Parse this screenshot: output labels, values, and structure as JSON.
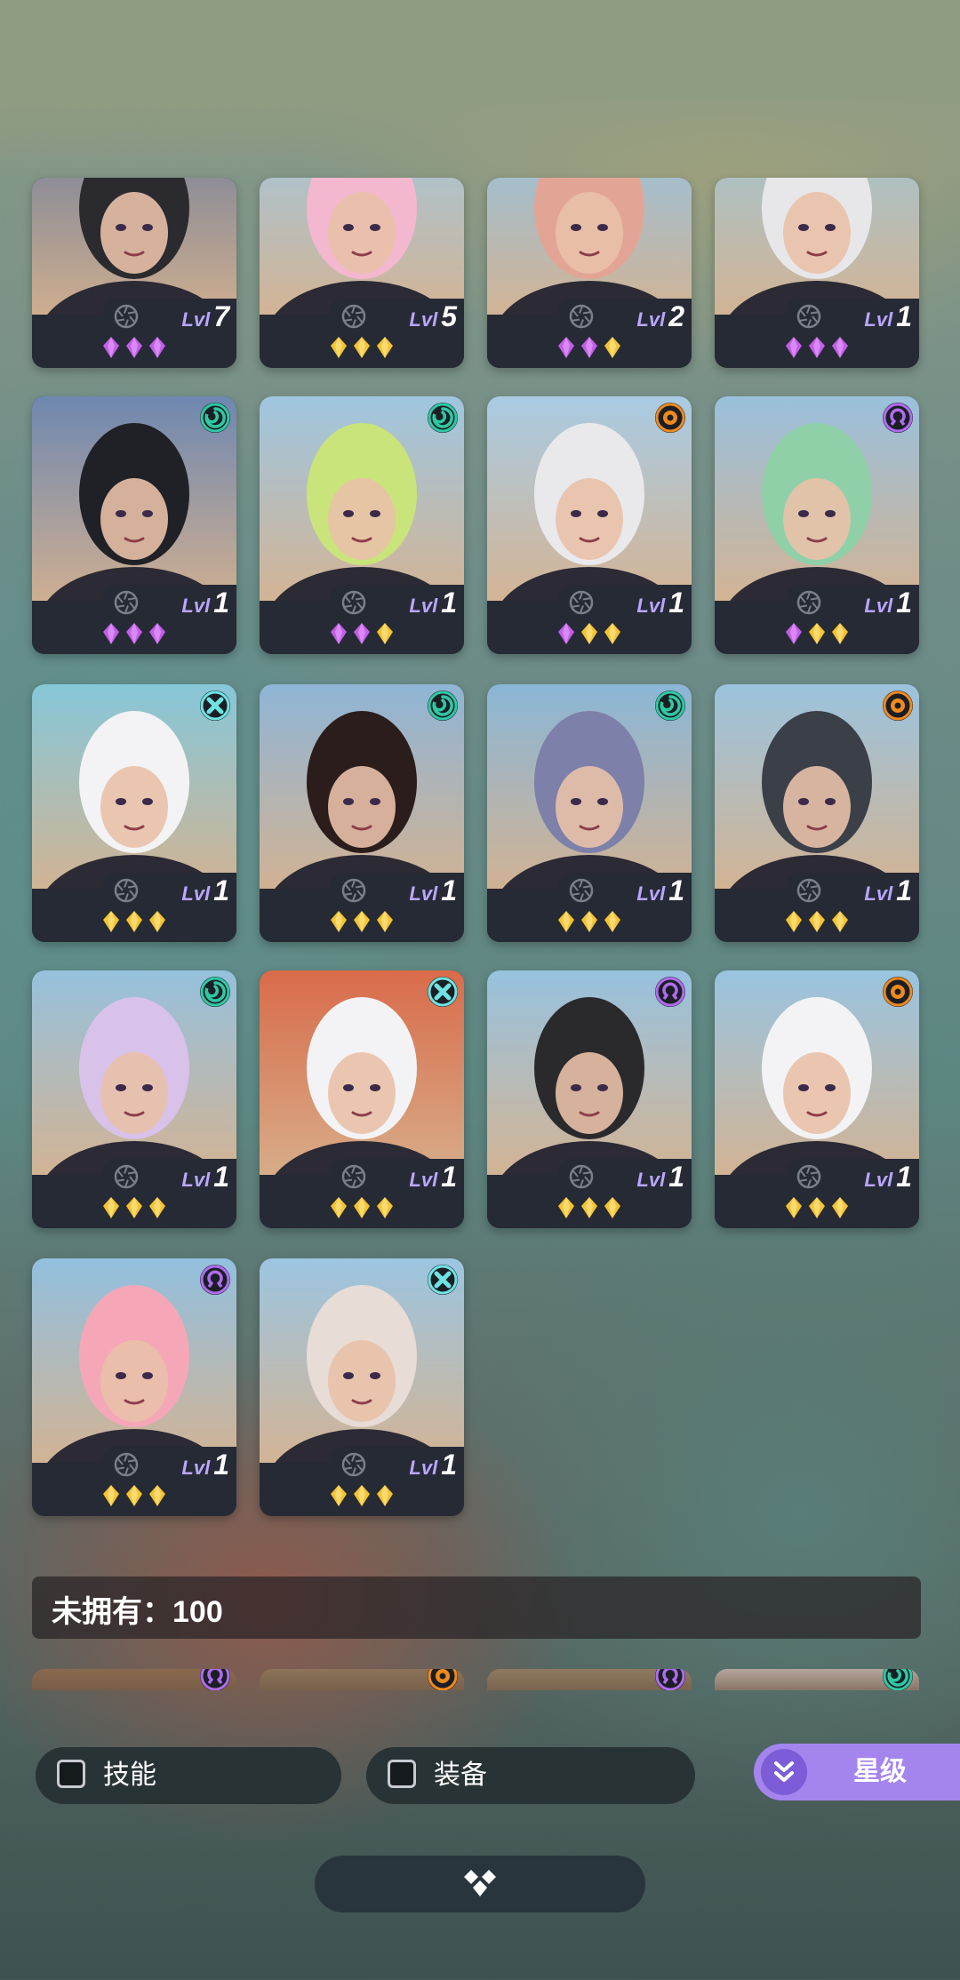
{
  "colors": {
    "card_bg": "#262a35",
    "diamond_purple": "#c25ee8",
    "diamond_gold": "#f4c430",
    "accent_purple": "#a485ee",
    "faction_green": "#2ec9a5",
    "faction_orange": "#f08a1c",
    "faction_violet": "#b06cf0",
    "faction_cyan": "#6fe3e3"
  },
  "owned_cards": [
    {
      "level_prefix": "Lvl",
      "level": "7",
      "faction": "none",
      "stars": [
        "purple",
        "purple",
        "purple"
      ],
      "bg": "#6d7d9a",
      "tone": "#2b2a2f"
    },
    {
      "level_prefix": "Lvl",
      "level": "5",
      "faction": "none",
      "stars": [
        "gold",
        "gold",
        "gold"
      ],
      "bg": "#9fc8e2",
      "tone": "#f3b8cf"
    },
    {
      "level_prefix": "Lvl",
      "level": "2",
      "faction": "none",
      "stars": [
        "purple",
        "purple",
        "gold"
      ],
      "bg": "#8fc3e6",
      "tone": "#e2a595"
    },
    {
      "level_prefix": "Lvl",
      "level": "1",
      "faction": "none",
      "stars": [
        "purple",
        "purple",
        "purple"
      ],
      "bg": "#9cc6d8",
      "tone": "#e7e7ea"
    },
    {
      "level_prefix": "Lvl",
      "level": "1",
      "faction": "green",
      "stars": [
        "purple",
        "purple",
        "purple"
      ],
      "bg": "#6e87b0",
      "tone": "#202127"
    },
    {
      "level_prefix": "Lvl",
      "level": "1",
      "faction": "green",
      "stars": [
        "purple",
        "purple",
        "gold"
      ],
      "bg": "#9fc6e0",
      "tone": "#c9e47a"
    },
    {
      "level_prefix": "Lvl",
      "level": "1",
      "faction": "orange",
      "stars": [
        "purple",
        "gold",
        "gold"
      ],
      "bg": "#a9cbe3",
      "tone": "#e9e9ec"
    },
    {
      "level_prefix": "Lvl",
      "level": "1",
      "faction": "violet",
      "stars": [
        "purple",
        "gold",
        "gold"
      ],
      "bg": "#99c0dc",
      "tone": "#8fd0a9"
    },
    {
      "level_prefix": "Lvl",
      "level": "1",
      "faction": "cyan",
      "stars": [
        "gold",
        "gold",
        "gold"
      ],
      "bg": "#86c7d9",
      "tone": "#f3f3f5"
    },
    {
      "level_prefix": "Lvl",
      "level": "1",
      "faction": "green",
      "stars": [
        "gold",
        "gold",
        "gold"
      ],
      "bg": "#8fb5d6",
      "tone": "#2b1d1b"
    },
    {
      "level_prefix": "Lvl",
      "level": "1",
      "faction": "green",
      "stars": [
        "gold",
        "gold",
        "gold"
      ],
      "bg": "#8ab6d7",
      "tone": "#7d80a8"
    },
    {
      "level_prefix": "Lvl",
      "level": "1",
      "faction": "orange",
      "stars": [
        "gold",
        "gold",
        "gold"
      ],
      "bg": "#9bc3dd",
      "tone": "#3a3f48"
    },
    {
      "level_prefix": "Lvl",
      "level": "1",
      "faction": "green",
      "stars": [
        "gold",
        "gold",
        "gold"
      ],
      "bg": "#96c1dd",
      "tone": "#d8c2ea"
    },
    {
      "level_prefix": "Lvl",
      "level": "1",
      "faction": "cyan",
      "stars": [
        "gold",
        "gold",
        "gold"
      ],
      "bg": "#d96b4a",
      "tone": "#f3f3f5"
    },
    {
      "level_prefix": "Lvl",
      "level": "1",
      "faction": "violet",
      "stars": [
        "gold",
        "gold",
        "gold"
      ],
      "bg": "#97c2df",
      "tone": "#2a2a2d"
    },
    {
      "level_prefix": "Lvl",
      "level": "1",
      "faction": "orange",
      "stars": [
        "gold",
        "gold",
        "gold"
      ],
      "bg": "#99c4e0",
      "tone": "#f3f3f5"
    },
    {
      "level_prefix": "Lvl",
      "level": "1",
      "faction": "violet",
      "stars": [
        "gold",
        "gold",
        "gold"
      ],
      "bg": "#92c0df",
      "tone": "#f5a7b8"
    },
    {
      "level_prefix": "Lvl",
      "level": "1",
      "faction": "cyan",
      "stars": [
        "gold",
        "gold",
        "gold"
      ],
      "bg": "#9cc5e1",
      "tone": "#e7dcd6"
    }
  ],
  "unowned_section": {
    "label": "未拥有：100"
  },
  "unowned_partial_cards": [
    {
      "faction": "violet",
      "bg": "#8a6a4e"
    },
    {
      "faction": "orange",
      "bg": "#8c7358"
    },
    {
      "faction": "violet",
      "bg": "#8f7a60"
    },
    {
      "faction": "green",
      "bg": "#b4a59b"
    }
  ],
  "filters": {
    "skill_label": "技能",
    "skill_checked": false,
    "equipment_label": "装备",
    "equipment_checked": false,
    "sort_label": "星级",
    "sort_icon": "chevron-double-down-icon"
  },
  "collapse": {
    "icon": "diamond-cluster-icon"
  }
}
